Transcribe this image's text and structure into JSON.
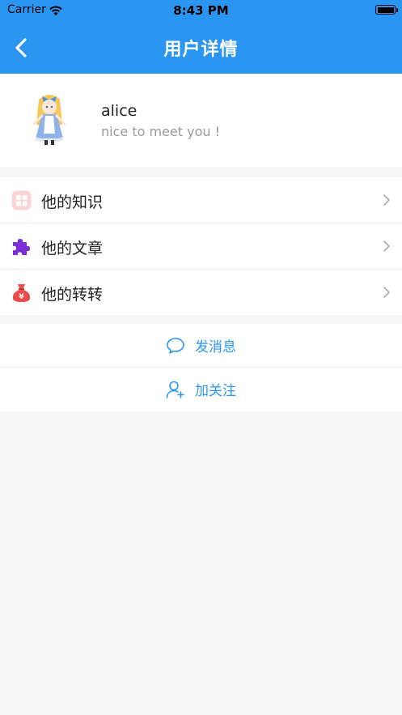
{
  "status_bar": {
    "carrier": "Carrier",
    "time": "8:43 PM"
  },
  "nav": {
    "title": "用户详情",
    "back_icon": "chevron-left-icon"
  },
  "profile": {
    "name": "alice",
    "bio": "nice to meet you !"
  },
  "menu": {
    "items": [
      {
        "label": "他的知识",
        "icon": "knowledge-icon",
        "color": "#f08d8d"
      },
      {
        "label": "他的文章",
        "icon": "puzzle-icon",
        "color": "#7b2fd6"
      },
      {
        "label": "他的转转",
        "icon": "money-bag-icon",
        "color": "#ec4b4b"
      }
    ]
  },
  "actions": {
    "send_message": "发消息",
    "follow": "加关注"
  },
  "colors": {
    "primary": "#2b96f2",
    "page_background": "#f7f7f7"
  }
}
